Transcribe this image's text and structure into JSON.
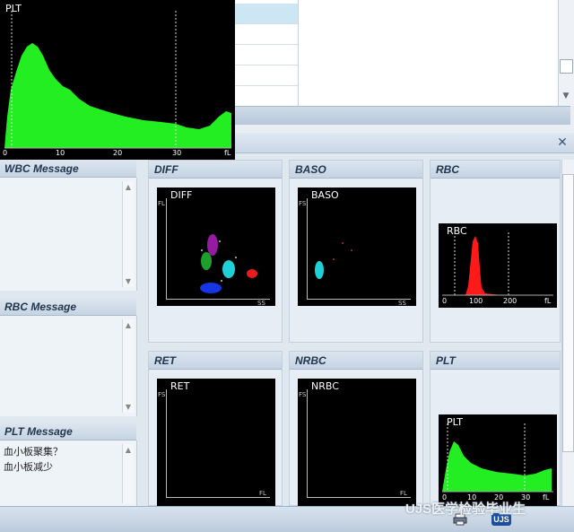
{
  "messages": {
    "wbc_title": "WBC Message",
    "rbc_title": "RBC Message",
    "plt_title": "PLT Message",
    "plt_lines": [
      "血小板聚集？",
      "血小板减少"
    ]
  },
  "panels": {
    "diff": {
      "title": "DIFF",
      "label": "DIFF",
      "y_axis": "FL",
      "x_axis": "SS"
    },
    "baso": {
      "title": "BASO",
      "label": "BASO",
      "y_axis": "FS",
      "x_axis": "SS"
    },
    "rbc": {
      "title": "RBC",
      "label": "RBC",
      "ticks": [
        "0",
        "100",
        "200",
        "fL"
      ]
    },
    "ret": {
      "title": "RET",
      "label": "RET",
      "y_axis": "FS",
      "x_axis": "FL"
    },
    "nrbc": {
      "title": "NRBC",
      "label": "NRBC",
      "y_axis": "FS",
      "x_axis": "FL"
    },
    "plt": {
      "title": "PLT",
      "label": "PLT",
      "ticks": [
        "0",
        "10",
        "20",
        "30",
        "fL"
      ]
    }
  },
  "big_plt": {
    "label": "PLT",
    "ticks": [
      "0",
      "10",
      "20",
      "30",
      "fL"
    ]
  },
  "footer": {
    "badge": "UJS",
    "watermark": "UJS医学检验毕业生"
  },
  "colors": {
    "histogram_green": "#22ee22",
    "rbc_red": "#ff1a1a",
    "plot_bg": "#000000"
  }
}
